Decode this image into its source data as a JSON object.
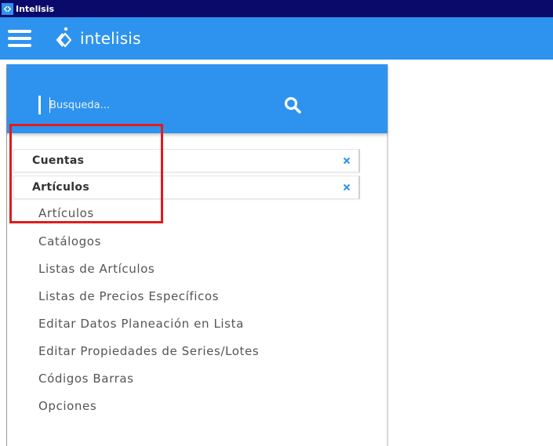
{
  "window": {
    "title": "Intelisis"
  },
  "topbar": {
    "brand_name": "intelisis"
  },
  "search": {
    "placeholder": "Busqueda..."
  },
  "groups": [
    {
      "label": "Cuentas",
      "close": "×"
    },
    {
      "label": "Artículos",
      "close": "×"
    }
  ],
  "menu_items": [
    {
      "label": "Artículos"
    },
    {
      "label": "Catálogos"
    },
    {
      "label": "Listas de Artículos"
    },
    {
      "label": "Listas de Precios Específicos"
    },
    {
      "label": "Editar Datos Planeación en Lista"
    },
    {
      "label": "Editar Propiedades de Series/Lotes"
    },
    {
      "label": "Códigos Barras"
    },
    {
      "label": "Opciones"
    }
  ],
  "colors": {
    "titlebar": "#0a0a6b",
    "brand_blue": "#2e93ee",
    "close_icon": "#2e93ee",
    "highlight": "#e01b1b"
  }
}
